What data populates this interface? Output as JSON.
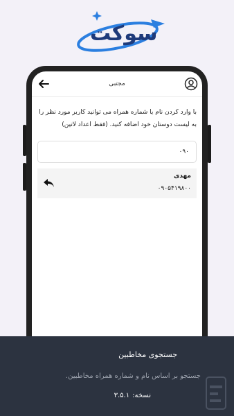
{
  "logo": {
    "text": "سوکت"
  },
  "app": {
    "title": "مجتبی",
    "instructions": "با وارد کردن نام یا شماره همراه می توانید کاربر مورد نظر را به لیست دوستان خود اضافه کنید. (فقط اعداد لاتین)",
    "input_value": "۰۹۰",
    "contact": {
      "name": "مهدی",
      "phone": "۰۹۰۵۴۱۹۸۰۰"
    }
  },
  "footer": {
    "heading": "جستجوی مخاطبین",
    "description": "جستجو بر اساس نام و شماره همراه مخاطبین.",
    "version_label": "نسخه:",
    "version_value": "۳.۵.۱"
  }
}
